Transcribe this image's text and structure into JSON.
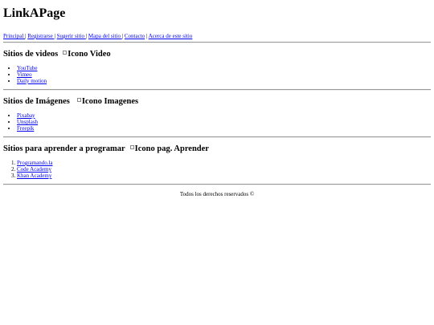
{
  "site": {
    "title": "LinkAPage"
  },
  "nav": {
    "items": [
      {
        "label": "Principal "
      },
      {
        "label": "Registrarse "
      },
      {
        "label": "Sugerir sitio "
      },
      {
        "label": "Mapa del sitio "
      },
      {
        "label": "Contacto"
      },
      {
        "label": "Acerca de este sitio"
      }
    ],
    "separator": "|"
  },
  "sections": [
    {
      "heading": "Sitios de videos",
      "image_alt": "Icono Video",
      "links": [
        "YouTube",
        "Vimeo",
        "Daily motion"
      ]
    },
    {
      "heading": "Sitios de Imágenes",
      "image_alt": "Icono Imagenes",
      "links": [
        "Pixabay",
        "Unsplash",
        "Freepik"
      ]
    },
    {
      "heading": "Sitios para aprender a programar",
      "image_alt": "Icono pag. Aprender",
      "links": [
        "Programando.la",
        "Code Academy",
        "Khan Academy"
      ]
    }
  ],
  "footer": {
    "text": "Todos los derechos reservados ©"
  }
}
